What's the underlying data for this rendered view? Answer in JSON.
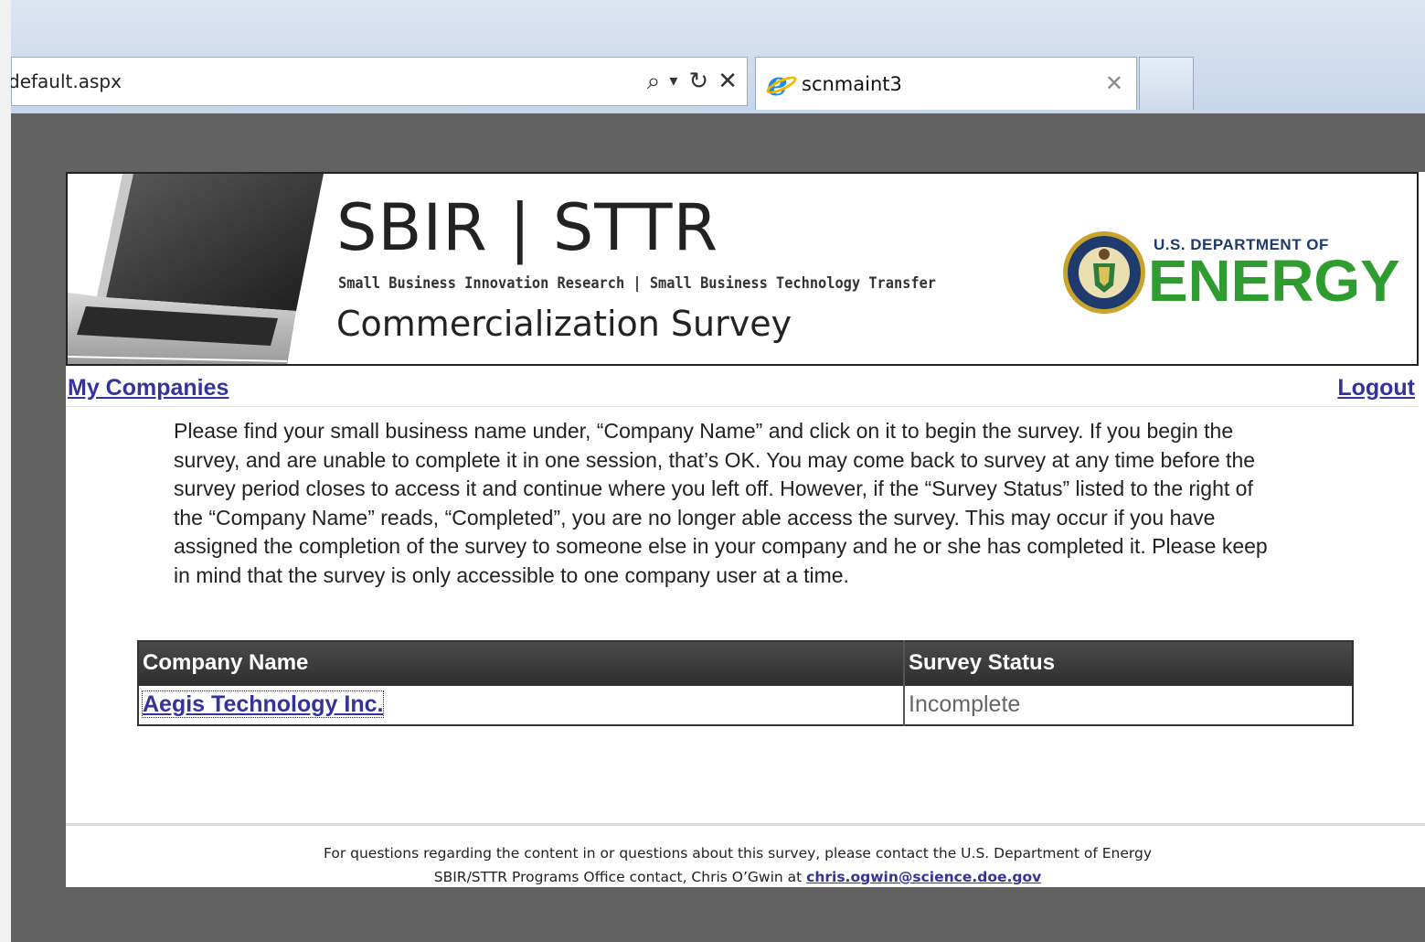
{
  "browser": {
    "address": "default.aspx",
    "search_glyph": "⌕",
    "dropdown_glyph": "▾",
    "refresh_glyph": "↻",
    "stop_glyph": "✕",
    "tab_title": "scnmaint3",
    "tab_close_glyph": "✕",
    "tab_icon": "internet-explorer-icon"
  },
  "banner": {
    "title": "SBIR | STTR",
    "subtitle": "Small Business Innovation Research | Small Business Technology Transfer",
    "survey_title": "Commercialization Survey",
    "doe_top": "U.S. DEPARTMENT OF",
    "doe_main": "ENERGY"
  },
  "nav": {
    "left_link": "My Companies",
    "right_link": "Logout"
  },
  "instructions": "Please find your small business name under, “Company Name” and click on it to begin the survey. If you begin the survey, and are unable to complete it in one session, that’s OK. You may come back to survey at any time before the survey period closes to access it and continue where you left off. However, if the “Survey Status” listed to the right of the “Company Name” reads, “Completed”, you are no longer able access the survey. This may occur if you have assigned the completion of the survey to someone else in your company and he or she has completed it. Please keep in mind that the survey is only accessible to one company user at a time.",
  "table": {
    "headers": [
      "Company Name",
      "Survey Status"
    ],
    "rows": [
      {
        "company": "Aegis Technology Inc.",
        "status": "Incomplete"
      }
    ]
  },
  "footer": {
    "line1": "For questions regarding the content in or questions about this survey, please contact the U.S. Department of Energy",
    "line2_prefix": "SBIR/STTR Programs Office contact, Chris O’Gwin at",
    "email": "chris.ogwin@science.doe.gov"
  },
  "colors": {
    "link": "#33339a",
    "energy_green": "#2e9c2e",
    "doe_navy": "#1f3a6d",
    "background": "#626262"
  }
}
